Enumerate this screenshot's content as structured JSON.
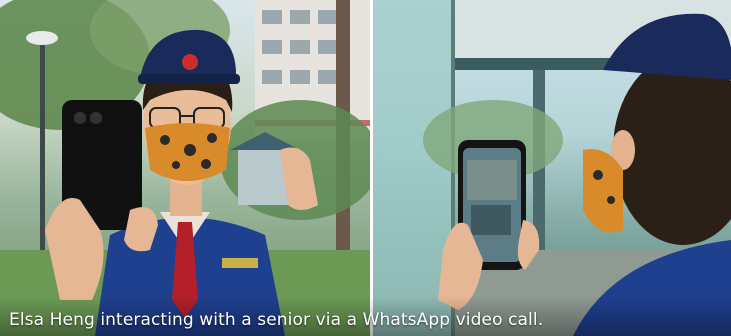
{
  "caption": {
    "text": "Elsa Heng interacting with a senior via a WhatsApp video call."
  },
  "colors": {
    "caption_text": "#ffffff",
    "uniform_blue": "#1f3f8f",
    "tie_red": "#b3202a",
    "cap_navy": "#1a2a5a",
    "mask_orange": "#d98a2a"
  },
  "icons": {
    "left_photo": "girl-with-phone-photo",
    "right_photo": "phone-screen-video-call-photo"
  }
}
